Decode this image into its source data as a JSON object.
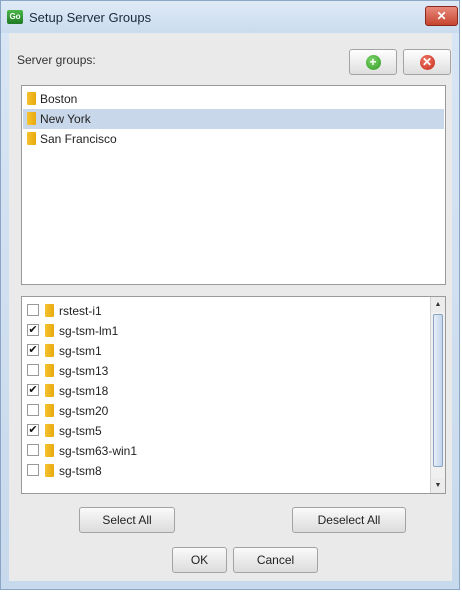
{
  "window": {
    "title": "Setup Server Groups",
    "app_icon": "Go",
    "close_glyph": "✕"
  },
  "groups": {
    "label": "Server groups:",
    "add_glyph": "+",
    "remove_glyph": "✕",
    "items": [
      {
        "label": "Boston",
        "selected": false
      },
      {
        "label": "New York",
        "selected": true
      },
      {
        "label": "San Francisco",
        "selected": false
      }
    ]
  },
  "servers": {
    "items": [
      {
        "label": "rstest-i1",
        "checked": false
      },
      {
        "label": "sg-tsm-lm1",
        "checked": true
      },
      {
        "label": "sg-tsm1",
        "checked": true
      },
      {
        "label": "sg-tsm13",
        "checked": false
      },
      {
        "label": "sg-tsm18",
        "checked": true
      },
      {
        "label": "sg-tsm20",
        "checked": false
      },
      {
        "label": "sg-tsm5",
        "checked": true
      },
      {
        "label": "sg-tsm63-win1",
        "checked": false
      },
      {
        "label": "sg-tsm8",
        "checked": false
      }
    ],
    "check_glyph": "✔",
    "scroll_up_glyph": "▲",
    "scroll_down_glyph": "▼"
  },
  "buttons": {
    "select_all": "Select All",
    "deselect_all": "Deselect All",
    "ok": "OK",
    "cancel": "Cancel"
  },
  "colors": {
    "selection": "#c8d7ea",
    "folder": "#f0b81f",
    "title_bar": "#d3e2f2"
  }
}
